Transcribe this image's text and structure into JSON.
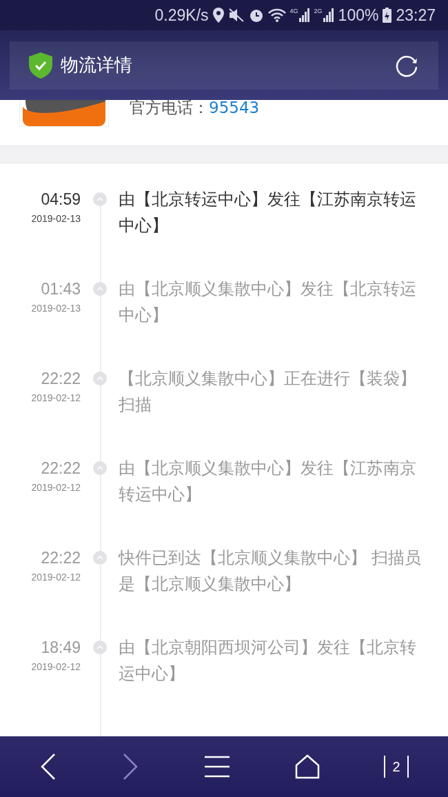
{
  "status_bar": {
    "speed": "0.29K/s",
    "network_4g": "4G",
    "network_2g": "2G",
    "battery": "100%",
    "time": "23:27"
  },
  "header": {
    "title": "物流详情"
  },
  "carrier": {
    "phone_label": "官方电话：",
    "phone": "95543"
  },
  "events": [
    {
      "time": "04:59",
      "date": "2019-02-13",
      "text": "由【北京转运中心】发往【江苏南京转运中心】",
      "latest": true
    },
    {
      "time": "01:43",
      "date": "2019-02-13",
      "text": "由【北京顺义集散中心】发往【北京转运中心】",
      "latest": false
    },
    {
      "time": "22:22",
      "date": "2019-02-12",
      "text": "【北京顺义集散中心】正在进行【装袋】扫描",
      "latest": false
    },
    {
      "time": "22:22",
      "date": "2019-02-12",
      "text": "由【北京顺义集散中心】发往【江苏南京转运中心】",
      "latest": false
    },
    {
      "time": "22:22",
      "date": "2019-02-12",
      "text": "快件已到达【北京顺义集散中心】 扫描员是【北京顺义集散中心】",
      "latest": false
    },
    {
      "time": "18:49",
      "date": "2019-02-12",
      "text": "由【北京朝阳西坝河公司】发往【北京转运中心】",
      "latest": false
    }
  ],
  "nav_bar": {
    "forward_disabled": true,
    "tab_count": "2"
  }
}
